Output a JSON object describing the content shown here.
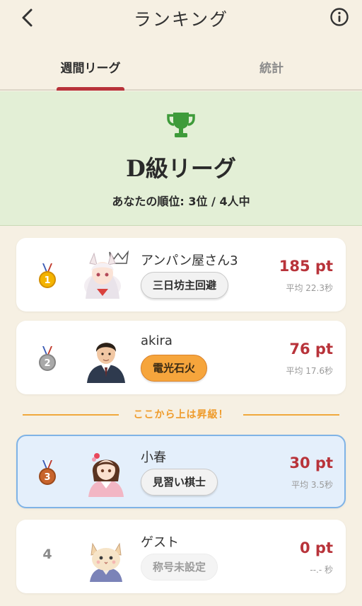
{
  "header": {
    "title": "ランキング"
  },
  "tabs": [
    {
      "label": "週間リーグ"
    },
    {
      "label": "統計"
    }
  ],
  "league": {
    "name": "D級リーグ",
    "rank_text": "あなたの順位: 3位 / 4人中",
    "trophy_color": "#3e9b3a"
  },
  "players": [
    {
      "rank": "1",
      "name": "アンパン屋さん3",
      "title": "三日坊主回避",
      "points": "185 pt",
      "avg": "平均 22.3秒",
      "medal": "gold"
    },
    {
      "rank": "2",
      "name": "akira",
      "title": "電光石火",
      "points": "76 pt",
      "avg": "平均 17.6秒",
      "medal": "silver"
    },
    {
      "rank": "3",
      "name": "小春",
      "title": "見習い棋士",
      "points": "30 pt",
      "avg": "平均 3.5秒",
      "medal": "bronze"
    },
    {
      "rank": "4",
      "name": "ゲスト",
      "title": "称号未設定",
      "points": "0 pt",
      "avg": "--.- 秒",
      "medal": "none"
    }
  ],
  "promotion_text": "ここから上は昇級！",
  "colors": {
    "accent": "#b8333a",
    "banner_bg": "#e3efd6",
    "highlight_bg": "#e4effb",
    "promo": "#ef9b2a"
  }
}
